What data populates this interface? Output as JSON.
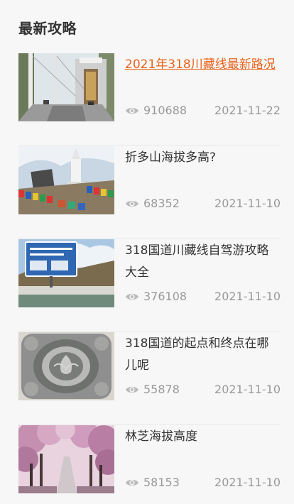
{
  "section": {
    "title": "最新攻略"
  },
  "articles": [
    {
      "title": "2021年318川藏线最新路况",
      "views": "910688",
      "date": "2021-11-22",
      "image": "suspension-bridge-photo"
    },
    {
      "title": "折多山海拔多高?",
      "views": "68352",
      "date": "2021-11-10",
      "image": "stupa-prayer-flags-photo"
    },
    {
      "title": "318国道川藏线自驾游攻略大全",
      "views": "376108",
      "date": "2021-11-10",
      "image": "tibet-border-sign-photo"
    },
    {
      "title": "318国道的起点和终点在哪儿呢",
      "views": "55878",
      "date": "2021-11-10",
      "image": "stone-emblem-plaque-photo"
    },
    {
      "title": "林芝海拔高度",
      "views": "58153",
      "date": "2021-11-10",
      "image": "peach-blossom-road-photo"
    }
  ],
  "icons": {
    "views": "eye-icon"
  },
  "colors": {
    "active_title": "#e8621a",
    "meta": "#999999",
    "background": "#f7f7f7"
  }
}
